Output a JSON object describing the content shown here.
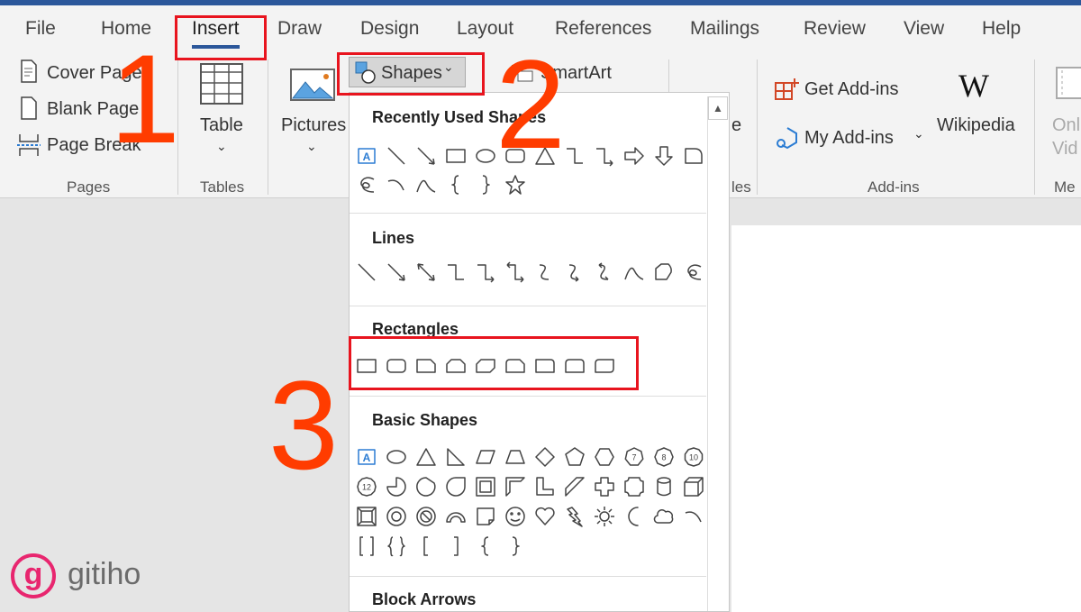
{
  "tabs": [
    "File",
    "Home",
    "Insert",
    "Draw",
    "Design",
    "Layout",
    "References",
    "Mailings",
    "Review",
    "View",
    "Help"
  ],
  "active_tab": "Insert",
  "ribbon": {
    "pages": {
      "cover_page": "Cover Page",
      "blank_page": "Blank Page",
      "page_break": "Page Break",
      "label": "Pages"
    },
    "tables": {
      "table": "Table",
      "label": "Tables"
    },
    "pictures": "Pictures",
    "shapes": "Shapes",
    "smartart": "SmartArt",
    "illustrations_label_partial": "les",
    "screenshot_partial": "e",
    "addins": {
      "get": "Get Add-ins",
      "my": "My Add-ins",
      "wikipedia": "Wikipedia",
      "wikipedia_logo": "W",
      "label": "Add-ins"
    },
    "online_video_partial": [
      "Onl",
      "Vid"
    ],
    "media_partial": "Me"
  },
  "dropdown": {
    "sections": [
      {
        "title": "Recently Used Shapes",
        "rows": [
          [
            "text-box",
            "line",
            "arrow",
            "rectangle",
            "oval",
            "rounded-rectangle",
            "triangle",
            "elbow",
            "elbow-arrow",
            "right-arrow",
            "down-arrow",
            "snip-shape"
          ],
          [
            "scribble",
            "arc",
            "curve",
            "left-brace",
            "right-brace",
            "star"
          ]
        ]
      },
      {
        "title": "Lines",
        "rows": [
          [
            "line",
            "arrow",
            "double-arrow",
            "elbow",
            "elbow-arrow",
            "elbow-double-arrow",
            "curved-connector",
            "curved-arrow",
            "curved-double-arrow",
            "curve",
            "freeform",
            "scribble"
          ]
        ]
      },
      {
        "title": "Rectangles",
        "rows": [
          [
            "rectangle",
            "rounded-rectangle",
            "snip-single",
            "snip-same",
            "snip-diagonal",
            "snip-round",
            "round-single",
            "round-same",
            "round-diagonal"
          ]
        ]
      },
      {
        "title": "Basic Shapes",
        "rows": [
          [
            "text-box",
            "oval",
            "triangle",
            "right-triangle",
            "parallelogram",
            "trapezoid",
            "diamond",
            "pentagon",
            "hexagon",
            "heptagon",
            "octagon",
            "decagon"
          ],
          [
            "dodecagon",
            "pie",
            "chord",
            "teardrop",
            "frame",
            "half-frame",
            "l-shape",
            "diagonal-stripe",
            "cross",
            "plaque",
            "can",
            "cube"
          ],
          [
            "bevel",
            "donut",
            "no-symbol",
            "block-arc",
            "folded-corner",
            "smiley",
            "heart",
            "lightning",
            "sun",
            "moon",
            "cloud",
            "arc"
          ],
          [
            "double-bracket",
            "double-brace",
            "left-bracket",
            "right-bracket",
            "left-brace",
            "right-brace"
          ]
        ]
      },
      {
        "title": "Block Arrows",
        "rows": []
      }
    ],
    "polygon_labels": {
      "heptagon": "7",
      "octagon": "8",
      "decagon": "10",
      "dodecagon": "12"
    }
  },
  "annotations": [
    "1",
    "2",
    "3"
  ],
  "annotation_color": "#ff3c00",
  "logo": {
    "mark": "g",
    "text": "gitiho"
  },
  "accent_color": "#2b579a"
}
